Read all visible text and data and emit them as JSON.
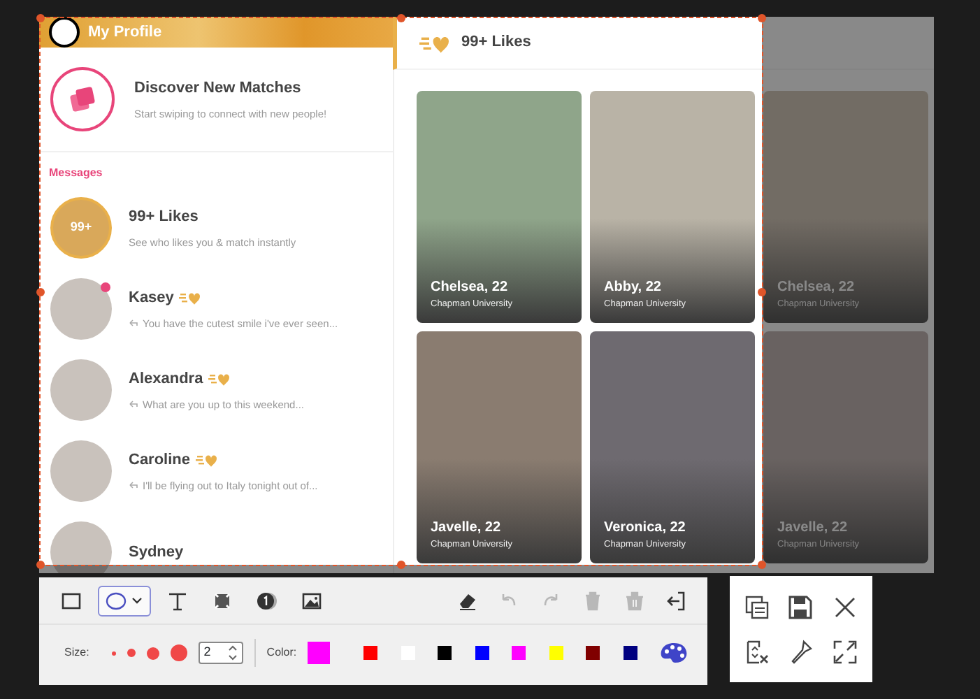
{
  "profile_header": {
    "title": "My Profile"
  },
  "discover": {
    "title": "Discover New Matches",
    "subtitle": "Start swiping to connect with new people!"
  },
  "messages_label": "Messages",
  "conversations": [
    {
      "kind": "likes",
      "name": "99+ Likes",
      "badge": "99+",
      "preview": "See who likes you & match instantly",
      "unread": false,
      "super_like": false
    },
    {
      "kind": "person",
      "name": "Kasey",
      "preview": "You have the cutest smile i've ever seen...",
      "unread": true,
      "super_like": true
    },
    {
      "kind": "person",
      "name": "Alexandra",
      "preview": "What are you up to this weekend...",
      "unread": false,
      "super_like": true
    },
    {
      "kind": "person",
      "name": "Caroline",
      "preview": "I'll be flying out to Italy tonight out of...",
      "unread": false,
      "super_like": true
    },
    {
      "kind": "person",
      "name": "Sydney",
      "unread": false,
      "super_like": false
    }
  ],
  "likes_panel": {
    "title": "99+ Likes",
    "cards": [
      {
        "name": "Chelsea, 22",
        "school": "Chapman University"
      },
      {
        "name": "Abby, 22",
        "school": "Chapman University"
      },
      {
        "name": "Chelsea, 22",
        "school": "Chapman University"
      },
      {
        "name": "Javelle, 22",
        "school": "Chapman University"
      },
      {
        "name": "Veronica, 22",
        "school": "Chapman University"
      },
      {
        "name": "Javelle, 22",
        "school": "Chapman University"
      }
    ]
  },
  "toolbar": {
    "tools": [
      {
        "kind": "rectangle",
        "selected": false
      },
      {
        "kind": "ellipse",
        "selected": true
      },
      {
        "kind": "text",
        "selected": false
      },
      {
        "kind": "mosaic",
        "selected": false
      },
      {
        "kind": "step",
        "selected": false
      },
      {
        "kind": "image",
        "selected": false
      }
    ],
    "actions": [
      {
        "kind": "eraser",
        "disabled": false
      },
      {
        "kind": "undo",
        "disabled": true
      },
      {
        "kind": "redo",
        "disabled": true
      },
      {
        "kind": "delete",
        "disabled": true
      },
      {
        "kind": "clear",
        "disabled": true
      },
      {
        "kind": "exit",
        "disabled": false
      }
    ],
    "size_label": "Size:",
    "size_value": "2",
    "color_label": "Color:",
    "current": {
      "color": "#ff00ff"
    },
    "swatches": [
      {
        "color": "#ff0000"
      },
      {
        "color": "#ffffff"
      },
      {
        "color": "#000000"
      },
      {
        "color": "#0000ff"
      },
      {
        "color": "#ff00ff"
      },
      {
        "color": "#ffff00"
      },
      {
        "color": "#800000"
      },
      {
        "color": "#000080"
      }
    ]
  },
  "side_panel": {
    "buttons": [
      {
        "kind": "copy"
      },
      {
        "kind": "save"
      },
      {
        "kind": "close"
      },
      {
        "kind": "ocr"
      },
      {
        "kind": "pin"
      },
      {
        "kind": "fullscreen"
      }
    ]
  }
}
